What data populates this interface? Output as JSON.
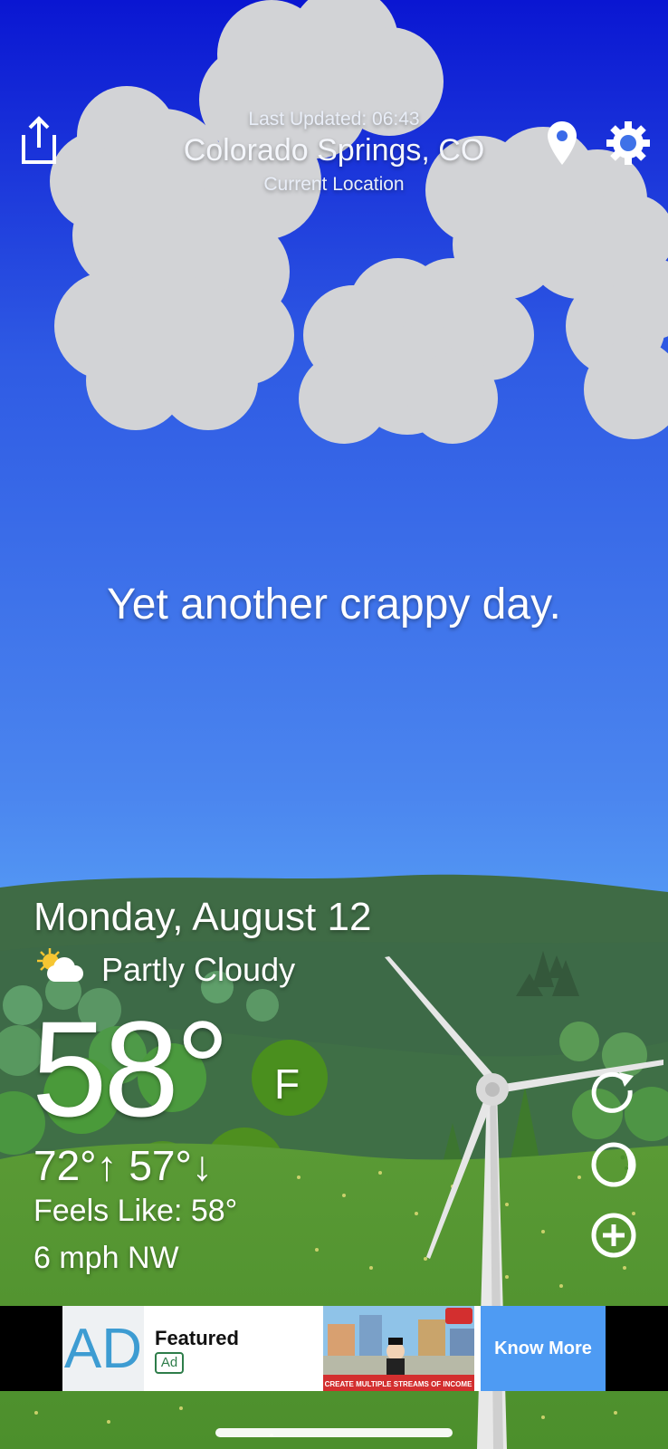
{
  "header": {
    "last_updated": "Last Updated: 06:43",
    "city": "Colorado Springs, CO",
    "location_label": "Current Location"
  },
  "tagline": "Yet another crappy day.",
  "weather": {
    "date": "Monday, August 12",
    "condition": "Partly Cloudy",
    "temperature": "58°",
    "unit": "F",
    "hi_lo": "72°↑  57°↓",
    "feels_like": "Feels Like: 58°",
    "wind": "6 mph NW"
  },
  "ad": {
    "logo_text": "AD",
    "title": "Featured",
    "badge": "Ad",
    "image_caption": "CREATE MULTIPLE STREAMS OF INCOME",
    "cta": "Know More"
  },
  "icons": {
    "share": "share-icon",
    "location": "location-pin-icon",
    "settings": "gear-icon",
    "refresh": "refresh-icon",
    "moon": "moon-icon",
    "add": "add-circle-icon",
    "condition": "partly-cloudy-icon"
  }
}
